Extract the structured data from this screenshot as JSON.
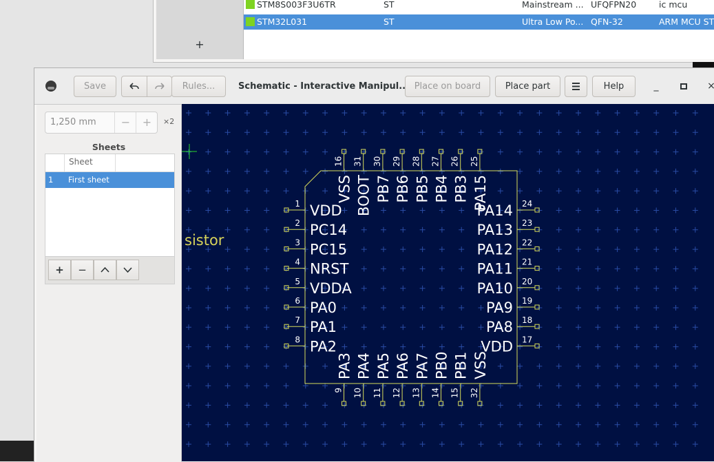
{
  "parts_table": {
    "add_button": "+",
    "rows": [
      {
        "mpn": "STM8S003F3U6TR",
        "manufacturer": "ST",
        "description": "Mainstream ...",
        "package": "UFQFPN20",
        "tags": "ic mcu",
        "selected": false
      },
      {
        "mpn": "STM32L031",
        "manufacturer": "ST",
        "description": "Ultra Low Po...",
        "package": "QFN-32",
        "tags": "ARM MCU ST",
        "selected": true
      }
    ]
  },
  "window": {
    "title": "Schematic - Interactive Manipul...",
    "save_label": "Save",
    "undo_icon": "undo-icon",
    "redo_icon": "redo-icon",
    "rules_label": "Rules...",
    "place_on_board_label": "Place on board",
    "place_part_label": "Place part",
    "menu_icon": "hamburger-icon",
    "help_label": "Help",
    "minimize_label": "_",
    "maximize_label": "□",
    "close_label": "×"
  },
  "side_panel": {
    "grid_value": "1,250 mm",
    "grid_minus": "−",
    "grid_plus": "+",
    "grid_multiplier": "×2",
    "sheets_title": "Sheets",
    "sheets_column": "Sheet",
    "sheets": [
      {
        "index": "1",
        "name": "First sheet"
      }
    ],
    "tools": [
      "+",
      "−",
      "^",
      "v"
    ]
  },
  "schematic": {
    "partial_text": "sistor",
    "left_pins": [
      {
        "num": "1",
        "name": "VDD"
      },
      {
        "num": "2",
        "name": "PC14"
      },
      {
        "num": "3",
        "name": "PC15"
      },
      {
        "num": "4",
        "name": "NRST"
      },
      {
        "num": "5",
        "name": "VDDA"
      },
      {
        "num": "6",
        "name": "PA0"
      },
      {
        "num": "7",
        "name": "PA1"
      },
      {
        "num": "8",
        "name": "PA2"
      }
    ],
    "right_pins": [
      {
        "num": "24",
        "name": "PA14"
      },
      {
        "num": "23",
        "name": "PA13"
      },
      {
        "num": "22",
        "name": "PA12"
      },
      {
        "num": "21",
        "name": "PA11"
      },
      {
        "num": "20",
        "name": "PA10"
      },
      {
        "num": "19",
        "name": "PA9"
      },
      {
        "num": "18",
        "name": "PA8"
      },
      {
        "num": "17",
        "name": "VDD"
      }
    ],
    "top_pins": [
      {
        "num": "16",
        "name": "VSS"
      },
      {
        "num": "31",
        "name": "BOOT"
      },
      {
        "num": "30",
        "name": "PB7"
      },
      {
        "num": "29",
        "name": "PB6"
      },
      {
        "num": "28",
        "name": "PB5"
      },
      {
        "num": "27",
        "name": "PB4"
      },
      {
        "num": "26",
        "name": "PB3"
      },
      {
        "num": "25",
        "name": "PA15"
      }
    ],
    "bottom_pins": [
      {
        "num": "9",
        "name": "PA3"
      },
      {
        "num": "10",
        "name": "PA4"
      },
      {
        "num": "11",
        "name": "PA5"
      },
      {
        "num": "12",
        "name": "PA6"
      },
      {
        "num": "13",
        "name": "PA7"
      },
      {
        "num": "14",
        "name": "PB0"
      },
      {
        "num": "15",
        "name": "PB1"
      },
      {
        "num": "32",
        "name": "VSS"
      }
    ],
    "colors": {
      "background": "#001042",
      "grid": "#2a4ca5",
      "symbol": "#d8dc5a",
      "text": "#ffffff"
    }
  }
}
